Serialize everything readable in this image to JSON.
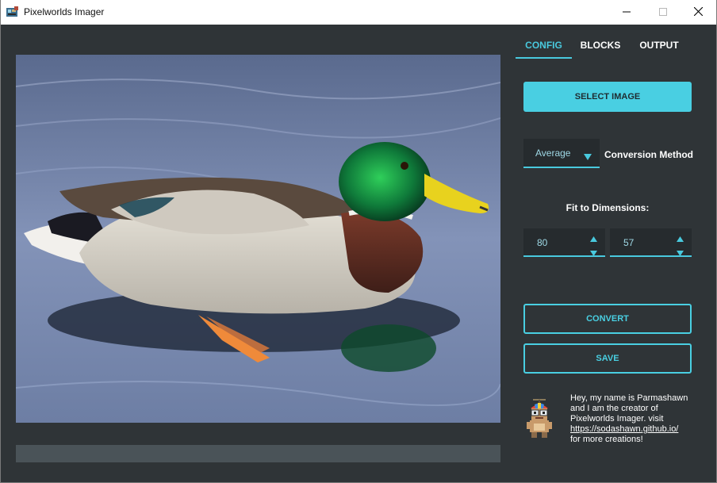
{
  "window": {
    "title": "Pixelworlds Imager",
    "icons": {
      "app": "app-icon",
      "minimize": "minimize-icon",
      "maximize": "maximize-icon",
      "close": "close-icon"
    }
  },
  "theme": {
    "background": "#2f3437",
    "accent": "#49cfe2",
    "field_background": "#262b2e",
    "progress_track": "#4a5358"
  },
  "tabs": [
    {
      "label": "CONFIG",
      "active": true
    },
    {
      "label": "BLOCKS",
      "active": false
    },
    {
      "label": "OUTPUT",
      "active": false
    }
  ],
  "config": {
    "select_image_label": "SELECT IMAGE",
    "conversion_method": {
      "value": "Average",
      "label": "Conversion Method"
    },
    "fit_label": "Fit to Dimensions:",
    "width_value": "80",
    "height_value": "57",
    "convert_label": "CONVERT",
    "save_label": "SAVE"
  },
  "preview": {
    "image_subject": "mallard duck swimming on water"
  },
  "progress": {
    "value": 0
  },
  "about": {
    "line1": "Hey, my name is Parmashawn",
    "line2": "and I am the creator of",
    "line3": "Pixelworlds Imager. visit",
    "link": "https://sodashawn.github.io/",
    "line5": "for more creations!",
    "mascot": "mascot-avatar"
  }
}
